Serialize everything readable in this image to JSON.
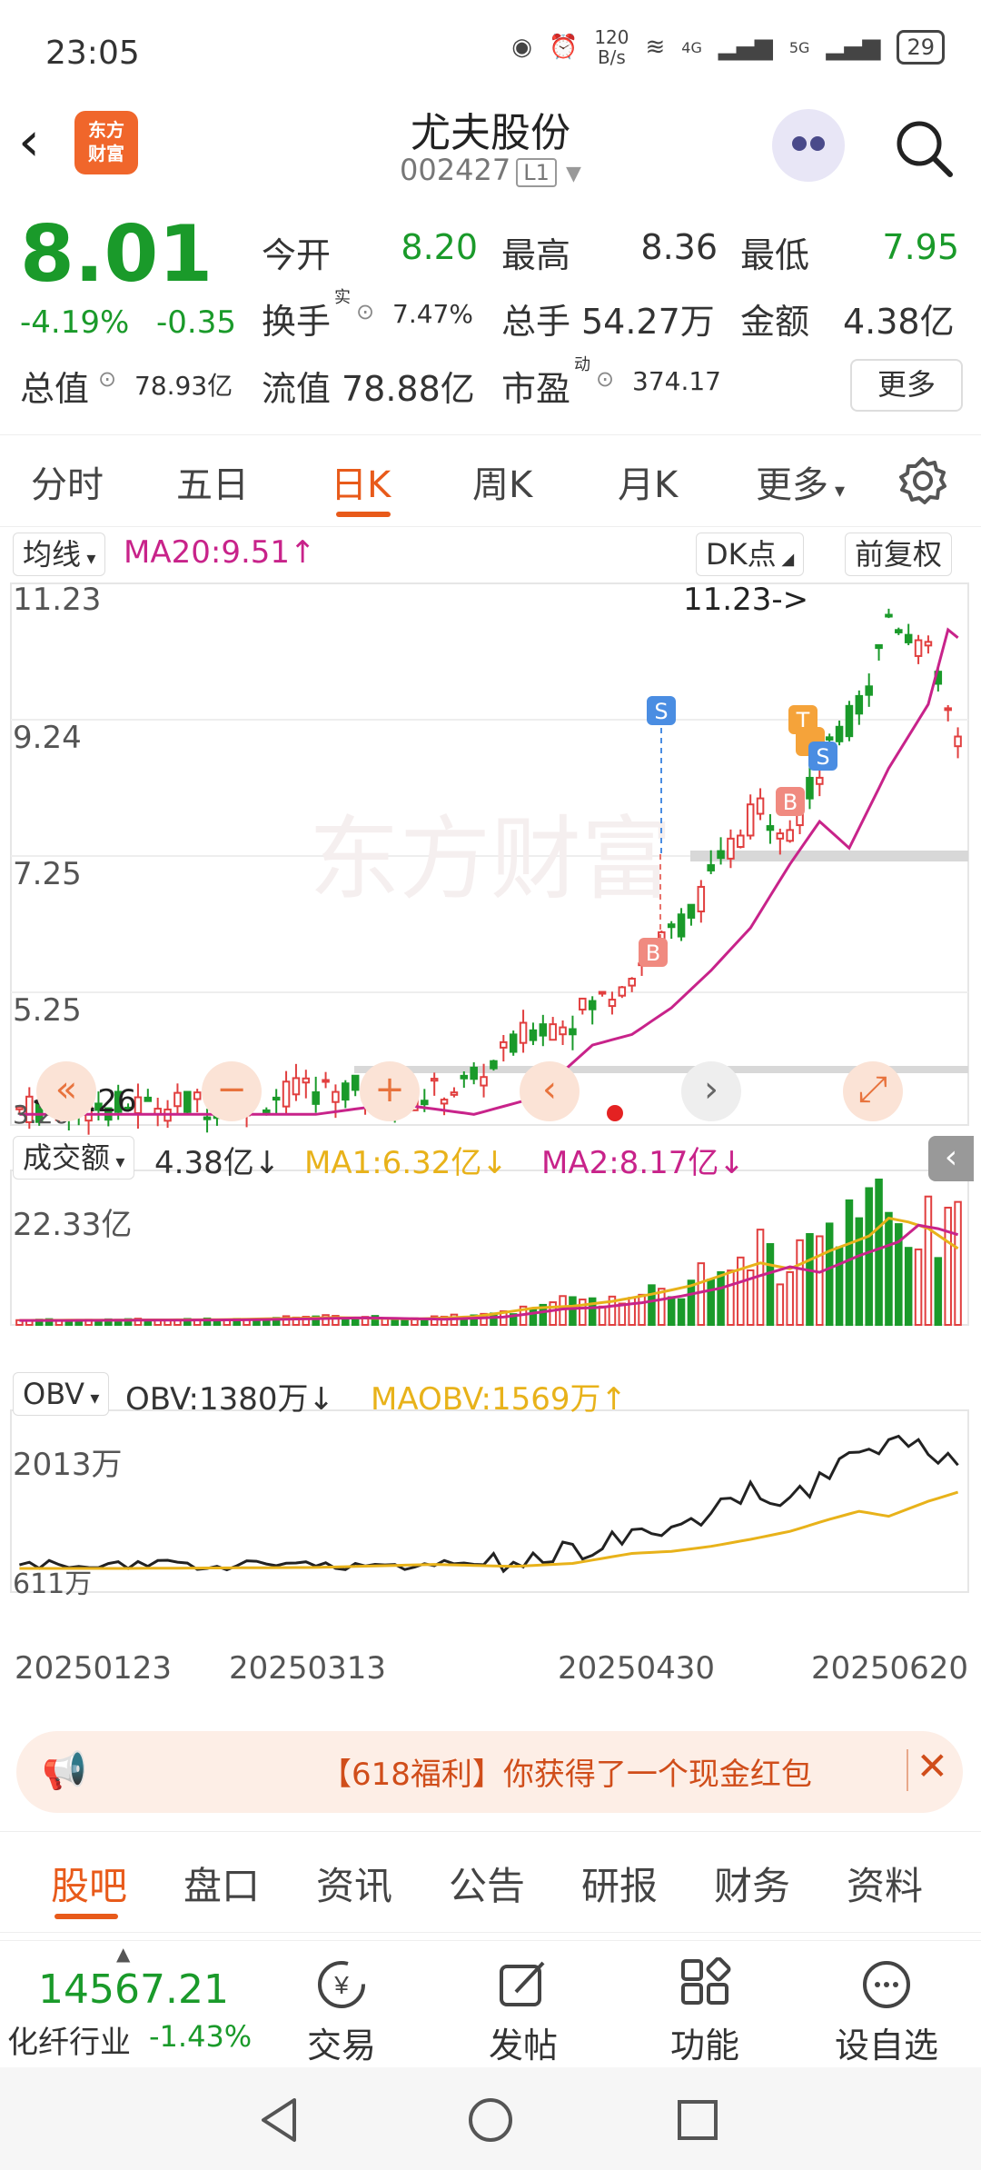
{
  "status_bar": {
    "time": "23:05",
    "net_speed_top": "120",
    "net_speed_unit": "B/s",
    "signal1": "4G",
    "signal2": "5G",
    "battery": "29"
  },
  "header": {
    "back_icon": "chevron-left-icon",
    "logo_line1": "东方",
    "logo_line2": "财富",
    "stock_name": "尤夫股份",
    "stock_code": "002427",
    "level": "L1"
  },
  "quote": {
    "price": "8.01",
    "change_pct": "-4.19%",
    "change": "-0.35",
    "open_label": "今开",
    "open": "8.20",
    "high_label": "最高",
    "high": "8.36",
    "low_label": "最低",
    "low": "7.95",
    "turnover_label": "换手",
    "turnover_sup": "实",
    "turnover": "7.47%",
    "volume_label": "总手",
    "volume": "54.27万",
    "amount_label": "金额",
    "amount": "4.38亿",
    "mktcap_label": "总值",
    "mktcap": "78.93亿",
    "float_label": "流值",
    "float_cap": "78.88亿",
    "pe_label": "市盈",
    "pe_sup": "动",
    "pe": "374.17",
    "more_button": "更多"
  },
  "tabs": [
    {
      "label": "分时"
    },
    {
      "label": "五日"
    },
    {
      "label": "日K"
    },
    {
      "label": "周K"
    },
    {
      "label": "月K"
    },
    {
      "label": "更多"
    }
  ],
  "chart_controls": {
    "ma_select": "均线",
    "ma20_label": "MA20:9.51",
    "dk_button": "DK点",
    "adjust_button": "前复权",
    "price_high_axis": "11.23",
    "price_mid1_axis": "9.24",
    "price_mid2_axis": "7.25",
    "price_low_axis": "5.25",
    "price_bottom_axis": "3.26",
    "peak_marker": "11.23->",
    "low_marker": "<-3.26",
    "watermark": "东方财富"
  },
  "volume_panel": {
    "select": "成交额",
    "value": "4.38亿",
    "ma1": "MA1:6.32亿",
    "ma2": "MA2:8.17亿",
    "axis_top": "22.33亿"
  },
  "obv_panel": {
    "select": "OBV",
    "value": "OBV:1380万",
    "maobv": "MAOBV:1569万",
    "axis_top": "2013万",
    "axis_bottom": "611万"
  },
  "dates": [
    "20250123",
    "20250313",
    "20250430",
    "20250620"
  ],
  "banner": {
    "text": "【618福利】你获得了一个现金红包"
  },
  "subtabs": [
    {
      "label": "股吧"
    },
    {
      "label": "盘口"
    },
    {
      "label": "资讯"
    },
    {
      "label": "公告"
    },
    {
      "label": "研报"
    },
    {
      "label": "财务"
    },
    {
      "label": "资料"
    }
  ],
  "toolbar": {
    "index_value": "14567.21",
    "index_name": "化纤行业",
    "index_pct": "-1.43%",
    "trade": "交易",
    "post": "发帖",
    "functions": "功能",
    "watchlist": "设自选"
  },
  "colors": {
    "up": "#e13f3f",
    "down": "#1a9a2a",
    "accent": "#e85a1a",
    "ma20": "#c8238a",
    "ma1": "#e8b21a"
  },
  "chart_data": [
    {
      "type": "candlestick",
      "title": "日K",
      "ylim": [
        3.26,
        11.23
      ],
      "x_start": "20250123",
      "x_end": "20250620",
      "series": [
        {
          "name": "MA20",
          "last": 9.51
        }
      ]
    },
    {
      "type": "bar",
      "title": "成交额",
      "ylim": [
        0,
        22.33
      ],
      "unit": "亿",
      "series": [
        {
          "name": "MA1",
          "last": 6.32
        },
        {
          "name": "MA2",
          "last": 8.17
        }
      ]
    },
    {
      "type": "line",
      "title": "OBV",
      "ylim": [
        611,
        2013
      ],
      "unit": "万",
      "series": [
        {
          "name": "OBV",
          "last": 1380
        },
        {
          "name": "MAOBV",
          "last": 1569
        }
      ]
    }
  ]
}
